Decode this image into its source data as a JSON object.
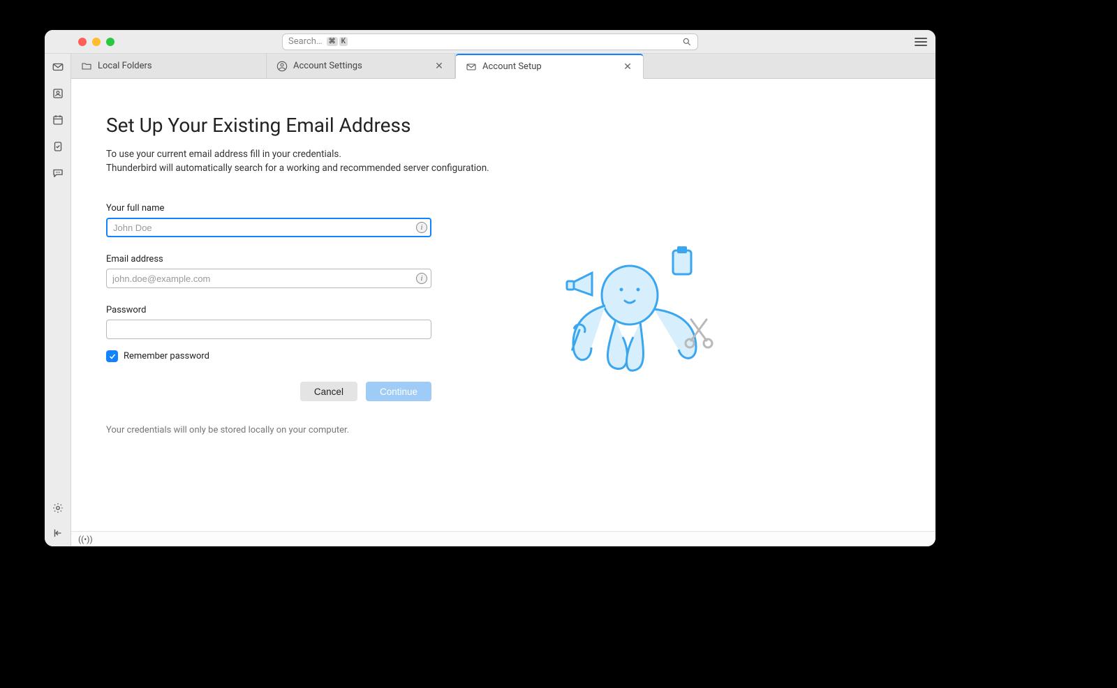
{
  "search": {
    "placeholder": "Search…",
    "shortcut": [
      "⌘",
      "K"
    ]
  },
  "tabs": [
    {
      "label": "Local Folders",
      "icon": "folder",
      "closable": false,
      "active": false
    },
    {
      "label": "Account Settings",
      "icon": "account",
      "closable": true,
      "active": false
    },
    {
      "label": "Account Setup",
      "icon": "mail-setup",
      "closable": true,
      "active": true
    }
  ],
  "sidebar_icons": [
    "mail",
    "contacts",
    "calendar",
    "tasks",
    "chat"
  ],
  "sidebar_bottom": [
    "settings",
    "collapse"
  ],
  "page": {
    "heading": "Set Up Your Existing Email Address",
    "desc_line1": "To use your current email address fill in your credentials.",
    "desc_line2": "Thunderbird will automatically search for a working and recommended server configuration.",
    "fields": {
      "name": {
        "label": "Your full name",
        "placeholder": "John Doe",
        "value": ""
      },
      "email": {
        "label": "Email address",
        "placeholder": "john.doe@example.com",
        "value": ""
      },
      "password": {
        "label": "Password",
        "placeholder": "",
        "value": ""
      }
    },
    "remember_label": "Remember password",
    "remember_checked": true,
    "buttons": {
      "cancel": "Cancel",
      "continue": "Continue"
    },
    "footnote": "Your credentials will only be stored locally on your computer."
  },
  "status": {
    "online_icon": "online"
  }
}
